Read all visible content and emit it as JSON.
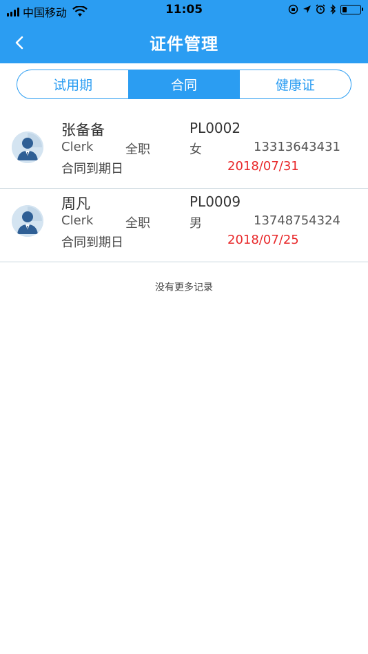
{
  "status_bar": {
    "carrier": "中国移动",
    "time": "11:05",
    "battery_level": 0.25
  },
  "nav": {
    "title": "证件管理"
  },
  "tabs": [
    {
      "label": "试用期",
      "active": false
    },
    {
      "label": "合同",
      "active": true
    },
    {
      "label": "健康证",
      "active": false
    }
  ],
  "records": [
    {
      "name": "张备备",
      "code": "PL0002",
      "position": "Clerk",
      "type": "全职",
      "gender": "女",
      "phone": "13313643431",
      "date_label": "合同到期日",
      "date": "2018/07/31"
    },
    {
      "name": "周凡",
      "code": "PL0009",
      "position": "Clerk",
      "type": "全职",
      "gender": "男",
      "phone": "13748754324",
      "date_label": "合同到期日",
      "date": "2018/07/25"
    }
  ],
  "footer": {
    "no_more": "没有更多记录"
  },
  "colors": {
    "accent": "#2b9df2",
    "date": "#e8282a"
  }
}
